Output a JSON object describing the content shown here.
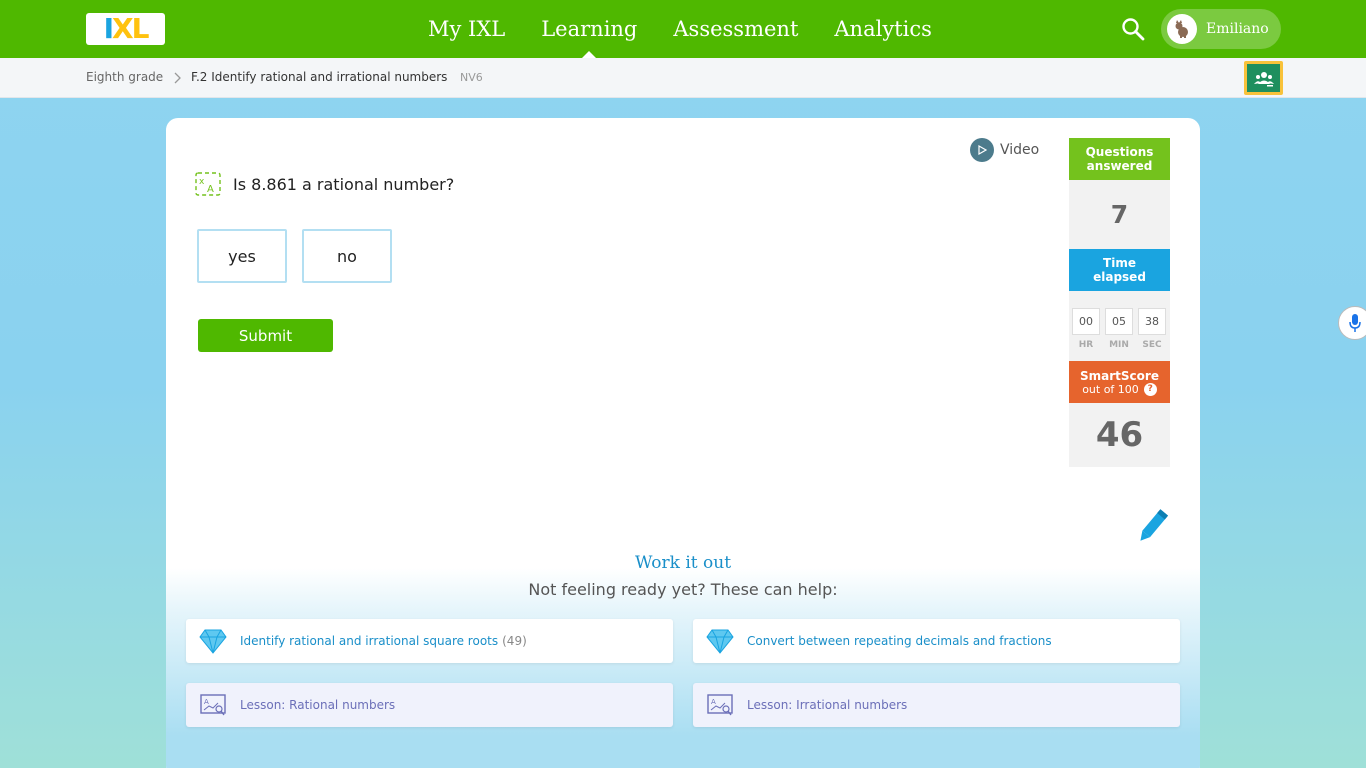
{
  "nav": {
    "logo": "IXL",
    "items": [
      "My IXL",
      "Learning",
      "Assessment",
      "Analytics"
    ],
    "active": "Learning",
    "user_name": "Emiliano"
  },
  "breadcrumb": {
    "grade": "Eighth grade",
    "skill": "F.2 Identify rational and irrational numbers",
    "code": "NV6"
  },
  "practice": {
    "video_label": "Video",
    "question": "Is 8.861 a rational number?",
    "choices": [
      "yes",
      "no"
    ],
    "submit_label": "Submit"
  },
  "stats": {
    "questions_label_1": "Questions",
    "questions_label_2": "answered",
    "questions_value": "7",
    "time_label_1": "Time",
    "time_label_2": "elapsed",
    "time_hr": "00",
    "time_min": "05",
    "time_sec": "38",
    "hr_label": "HR",
    "min_label": "MIN",
    "sec_label": "SEC",
    "smartscore_label": "SmartScore",
    "smartscore_sub": "out of 100",
    "help_glyph": "?",
    "smartscore_value": "46"
  },
  "help": {
    "title": "Work it out",
    "subtitle": "Not feeling ready yet? These can help:",
    "cards": [
      {
        "label": "Identify rational and irrational square roots",
        "count": "(49)",
        "icon": "diamond-icon"
      },
      {
        "label": "Convert between repeating decimals and fractions",
        "icon": "diamond-icon"
      },
      {
        "label": "Lesson: Rational numbers",
        "icon": "lesson-board-icon"
      },
      {
        "label": "Lesson: Irrational numbers",
        "icon": "lesson-board-icon"
      }
    ]
  },
  "colors": {
    "green": "#4fb800",
    "blue": "#1aa4e0",
    "orange": "#e6642d",
    "link": "#1a8fc9"
  }
}
